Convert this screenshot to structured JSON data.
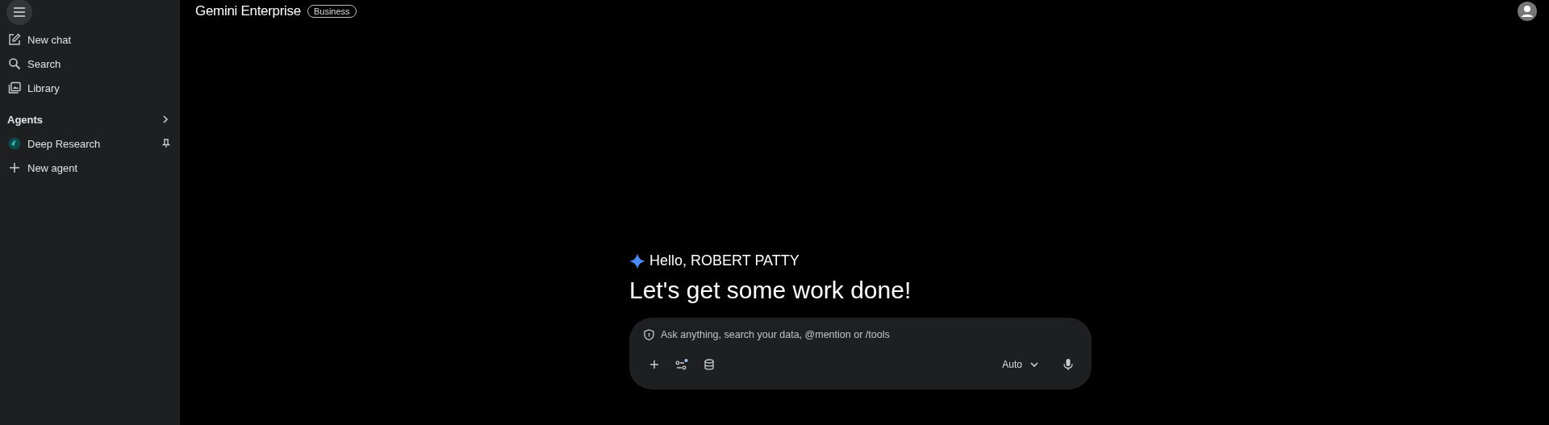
{
  "sidebar": {
    "nav_items": [
      {
        "kind": "new-chat",
        "label": "New chat"
      },
      {
        "kind": "search",
        "label": "Search"
      },
      {
        "kind": "library",
        "label": "Library"
      }
    ],
    "agents_heading": "Agents",
    "agents": [
      {
        "kind": "agent",
        "label": "Deep Research",
        "pinned": true
      },
      {
        "kind": "add",
        "label": "New agent"
      }
    ]
  },
  "header": {
    "title": "Gemini Enterprise",
    "badge": "Business"
  },
  "greeting": "Hello, ROBERT PATTY",
  "headline": "Let's get some work done!",
  "composer": {
    "placeholder": "Ask anything, search your data, @mention or /tools",
    "model": "Auto"
  }
}
